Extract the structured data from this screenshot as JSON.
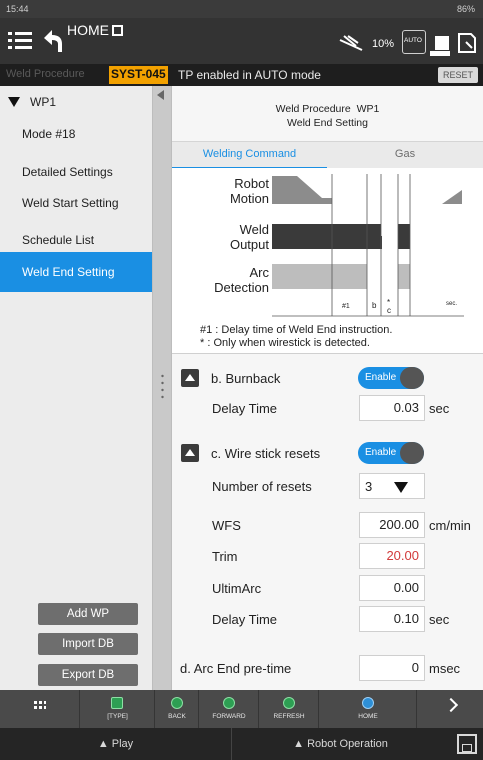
{
  "status_bar": {
    "time": "15:44",
    "battery": "86%"
  },
  "header": {
    "home_label": "HOME",
    "signal_pct": "10%",
    "auto_badge": "AUTO"
  },
  "status_line": {
    "procedure_label": "Weld Procedure",
    "program": "SYST-045",
    "message": "TP enabled in AUTO mode",
    "reset_label": "RESET"
  },
  "sidebar": {
    "tree_root": "WP1",
    "items": [
      {
        "label": "Mode #18"
      },
      {
        "label": "Detailed Settings"
      },
      {
        "label": "Weld Start Setting"
      },
      {
        "label": "Schedule List"
      },
      {
        "label": "Weld End Setting"
      }
    ],
    "buttons": {
      "add": "Add WP",
      "import": "Import DB",
      "export": "Export DB"
    }
  },
  "main": {
    "title_line1_label": "Weld Procedure",
    "title_line1_value": "WP1",
    "title_line2": "Weld End Setting",
    "tabs": [
      {
        "label": "Welding Command"
      },
      {
        "label": "Gas"
      }
    ],
    "diagram": {
      "row_labels": [
        "Robot",
        "Motion",
        "Weld",
        "Output",
        "Arc",
        "Detection"
      ],
      "tick_labels": [
        "#1",
        "b",
        "*",
        "c",
        "sec."
      ],
      "note1": "#1  : Delay time of Weld End instruction.",
      "note2": "*   : Only when wirestick is detected."
    },
    "burnback": {
      "label": "b.  Burnback",
      "toggle": "Enable",
      "delay_label": "Delay Time",
      "delay_value": "0.03",
      "delay_unit": "sec"
    },
    "wirestick": {
      "label": "c.  Wire stick resets",
      "toggle": "Enable",
      "resets_label": "Number of resets",
      "resets_value": "3",
      "wfs_label": "WFS",
      "wfs_value": "200.00",
      "wfs_unit": "cm/min",
      "trim_label": "Trim",
      "trim_value": "20.00",
      "ultimarc_label": "UltimArc",
      "ultimarc_value": "0.00",
      "delay_label": "Delay Time",
      "delay_value": "0.10",
      "delay_unit": "sec"
    },
    "arc_end": {
      "label": "d.  Arc End pre-time",
      "value": "0",
      "unit": "msec"
    }
  },
  "toolbar": {
    "type_label": "[TYPE]",
    "back_label": "BACK",
    "forward_label": "FORWARD",
    "refresh_label": "REFRESH",
    "home_label": "HOME"
  },
  "bottom_bar": {
    "play_label": "▲ Play",
    "robot_op_label": "▲ Robot Operation"
  },
  "colors": {
    "accent": "#1a8fe3",
    "trim_value": "#d23a3a",
    "program_badge": "#f2a100"
  }
}
